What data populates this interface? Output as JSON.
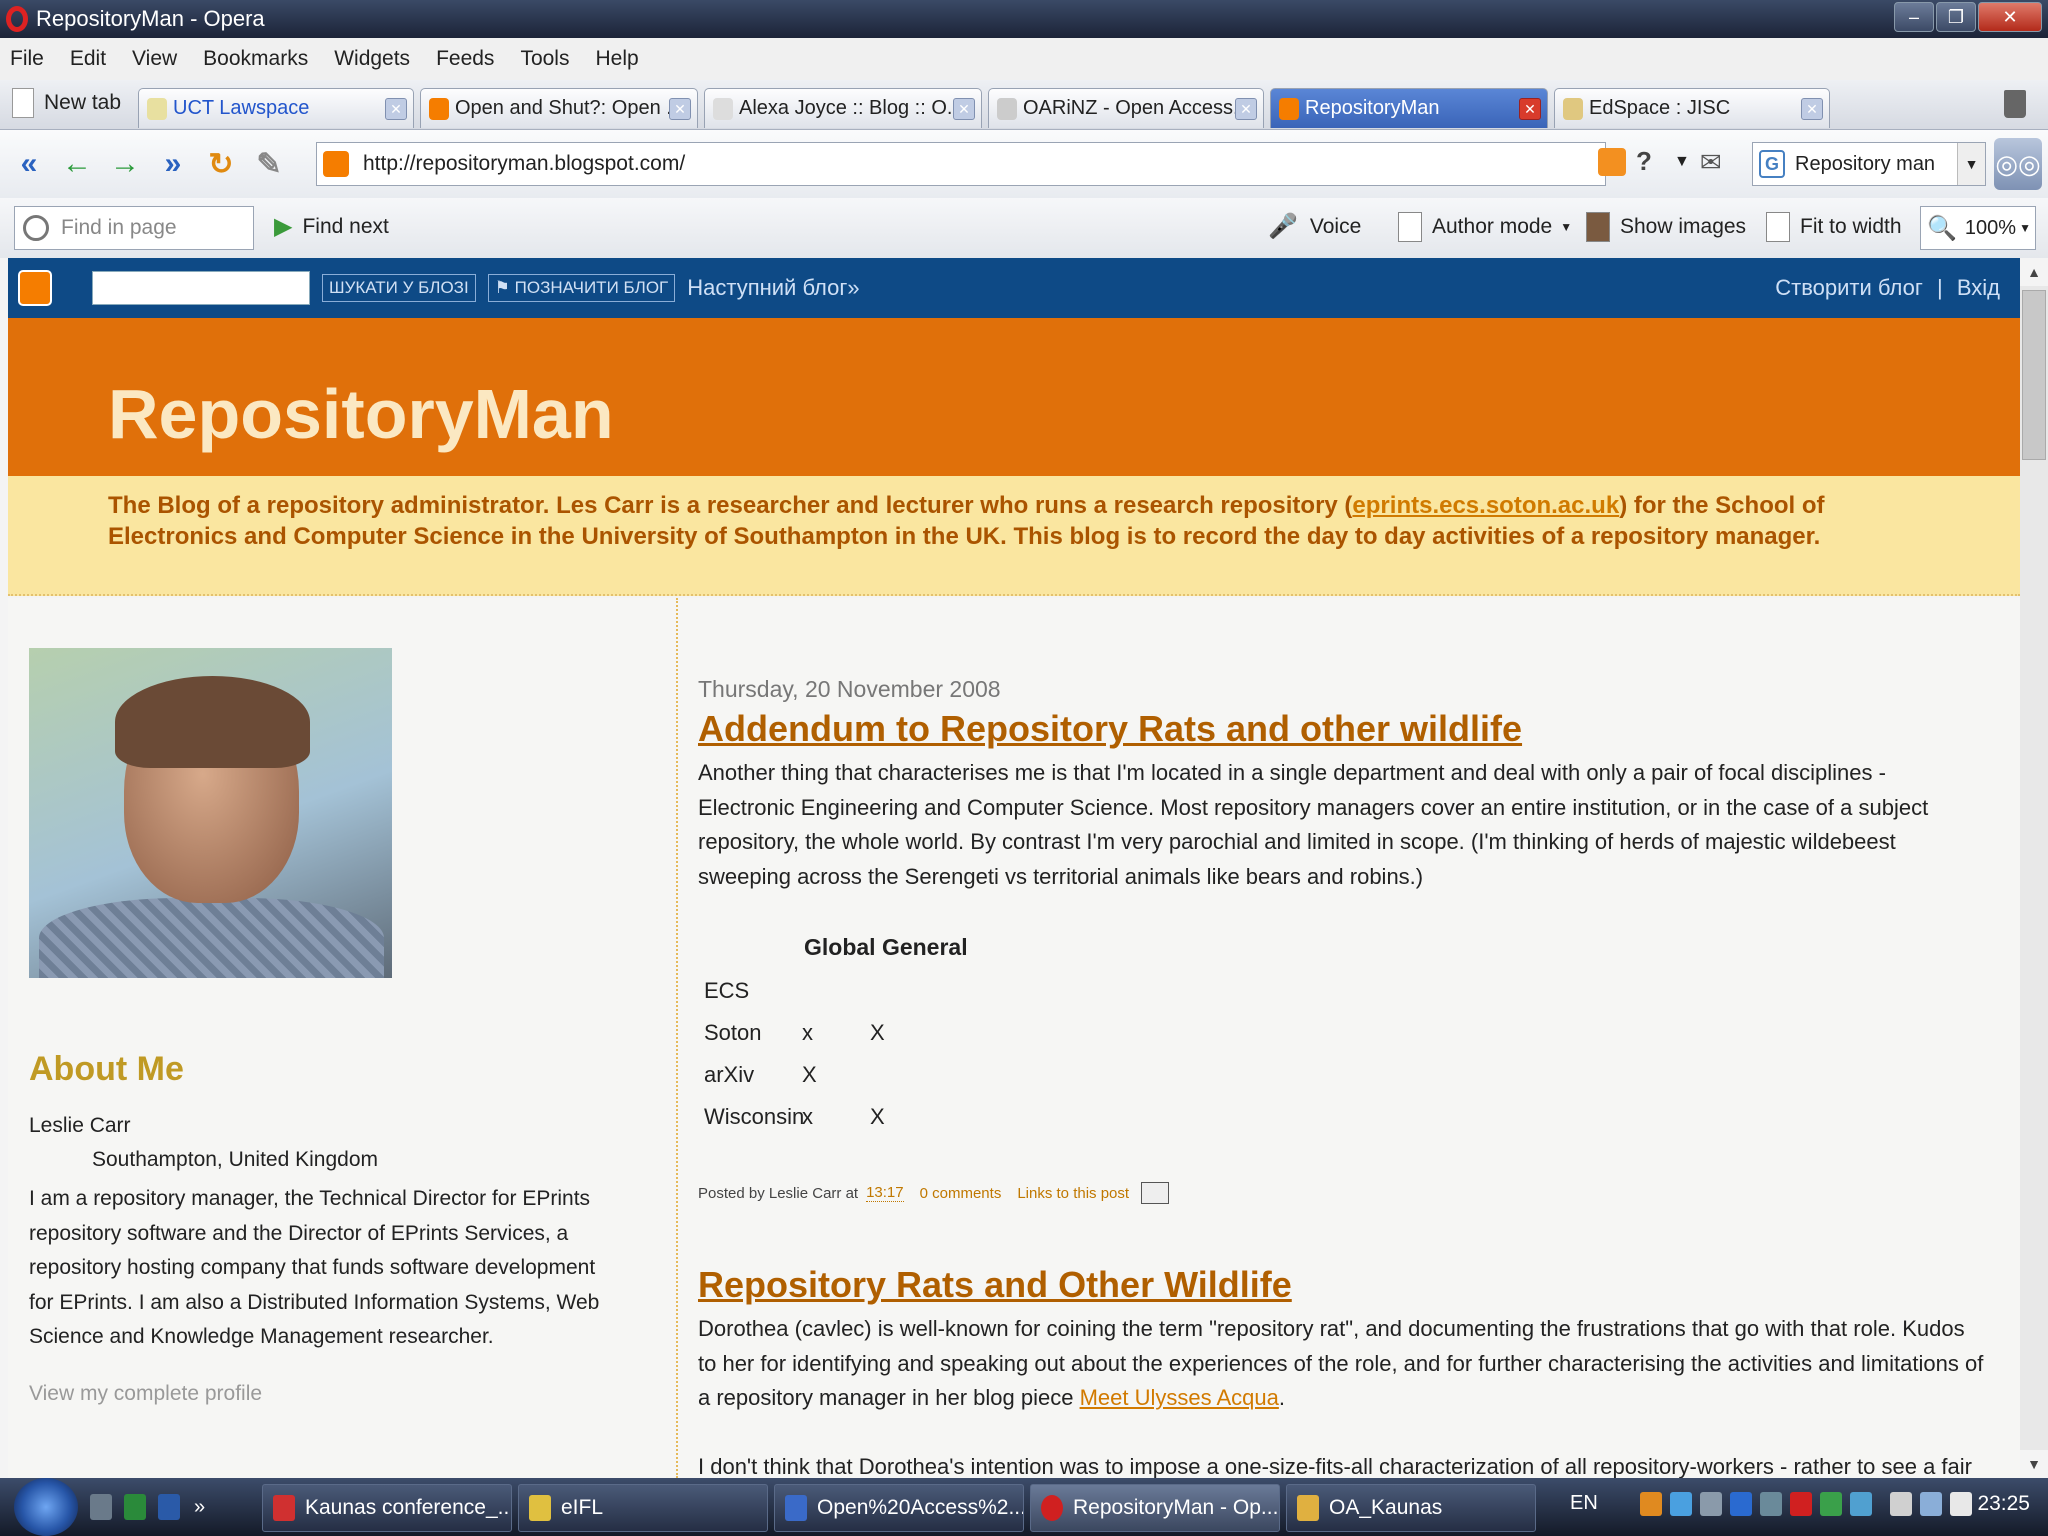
{
  "window": {
    "title": "RepositoryMan - Opera"
  },
  "menu": [
    "File",
    "Edit",
    "View",
    "Bookmarks",
    "Widgets",
    "Feeds",
    "Tools",
    "Help"
  ],
  "newtab_label": "New tab",
  "tabs": [
    {
      "label": "UCT Lawspace",
      "active": false,
      "color": "#e8e0a0"
    },
    {
      "label": "Open and Shut?: Open ...",
      "active": false,
      "color": "#f57d00"
    },
    {
      "label": "Alexa Joyce :: Blog :: O...",
      "active": false,
      "color": "#dddddd"
    },
    {
      "label": "OARiNZ - Open Access...",
      "active": false,
      "color": "#cccccc"
    },
    {
      "label": "RepositoryMan",
      "active": true,
      "color": "#f57d00"
    },
    {
      "label": "EdSpace : JISC",
      "active": false,
      "color": "#e0c880"
    }
  ],
  "address": {
    "url": "http://repositoryman.blogspot.com/",
    "search_value": "Repository man",
    "search_engine": "G"
  },
  "toolbar": {
    "find_placeholder": "Find in page",
    "find_next": "Find next",
    "voice": "Voice",
    "author_mode": "Author mode",
    "show_images": "Show images",
    "fit_to_width": "Fit to width",
    "zoom": "100%"
  },
  "blogger_nav": {
    "search_button": "ШУКАТИ У БЛОЗІ",
    "flag_button": "⚑ ПОЗНАЧИТИ БЛОГ",
    "next_blog": "Наступний блог»",
    "create_blog": "Створити блог",
    "separator": "|",
    "login": "Вхід"
  },
  "blog": {
    "title": "RepositoryMan",
    "description_pre": "The Blog of a repository administrator. Les Carr is a researcher and lecturer who runs a research repository (",
    "description_link": "eprints.ecs.soton.ac.uk",
    "description_post": ") for the School of Electronics and Computer Science in the University of Southampton in the UK. This blog is to record the day to day activities of a repository manager."
  },
  "sidebar": {
    "about_heading": "About Me",
    "name": "Leslie Carr",
    "location": "Southampton, United Kingdom",
    "bio": "I am a repository manager, the Technical Director for EPrints repository software and the Director of EPrints Services, a repository hosting company that funds software development for EPrints. I am also a Distributed Information Systems, Web Science and Knowledge Management researcher.",
    "profile_link": "View my complete profile"
  },
  "posts": [
    {
      "date": "Thursday, 20 November 2008",
      "title": "Addendum to Repository Rats and other wildlife",
      "body": "Another thing that characterises me is that I'm located in a single department and deal with only a pair of focal disciplines - Electronic Engineering and Computer Science. Most repository managers cover an entire institution, or in the case of a subject repository, the whole world. By contrast I'm very parochial and limited in scope. (I'm thinking of herds of majestic wildebeest sweeping across the Serengeti vs territorial animals like bears and robins.)",
      "table_header": "Global General",
      "table_rows": [
        [
          "ECS",
          "",
          ""
        ],
        [
          "Soton",
          "x",
          "X"
        ],
        [
          "arXiv",
          "X",
          ""
        ],
        [
          "Wisconsin",
          "x",
          "X"
        ]
      ],
      "posted_by": "Posted by Leslie Carr at",
      "time": "13:17",
      "comments": "0 comments",
      "links": "Links to this post"
    },
    {
      "title": "Repository Rats and Other Wildlife",
      "body_pre": "Dorothea (cavlec) is well-known for coining the term \"repository rat\", and documenting the frustrations that go with that role. Kudos to her for identifying and speaking out about the experiences of the role, and for further characterising the activities and limitations of a repository manager in her blog piece ",
      "body_link": "Meet Ulysses Acqua",
      "body_post": ".",
      "body2": "I don't think that Dorothea's intention was to impose a one-size-fits-all characterization of all repository-workers - rather to see a fair"
    }
  ],
  "taskbar": {
    "tasks": [
      {
        "label": "Kaunas conference_...",
        "color": "#d03030",
        "active": false
      },
      {
        "label": "eIFL",
        "color": "#e0c040",
        "active": false
      },
      {
        "label": "Open%20Access%2...",
        "color": "#3a6ac8",
        "active": false
      },
      {
        "label": "RepositoryMan - Op...",
        "color": "#d02020",
        "active": true
      },
      {
        "label": "OA_Kaunas",
        "color": "#e0b040",
        "active": false
      }
    ],
    "language": "EN",
    "clock": "23:25"
  }
}
